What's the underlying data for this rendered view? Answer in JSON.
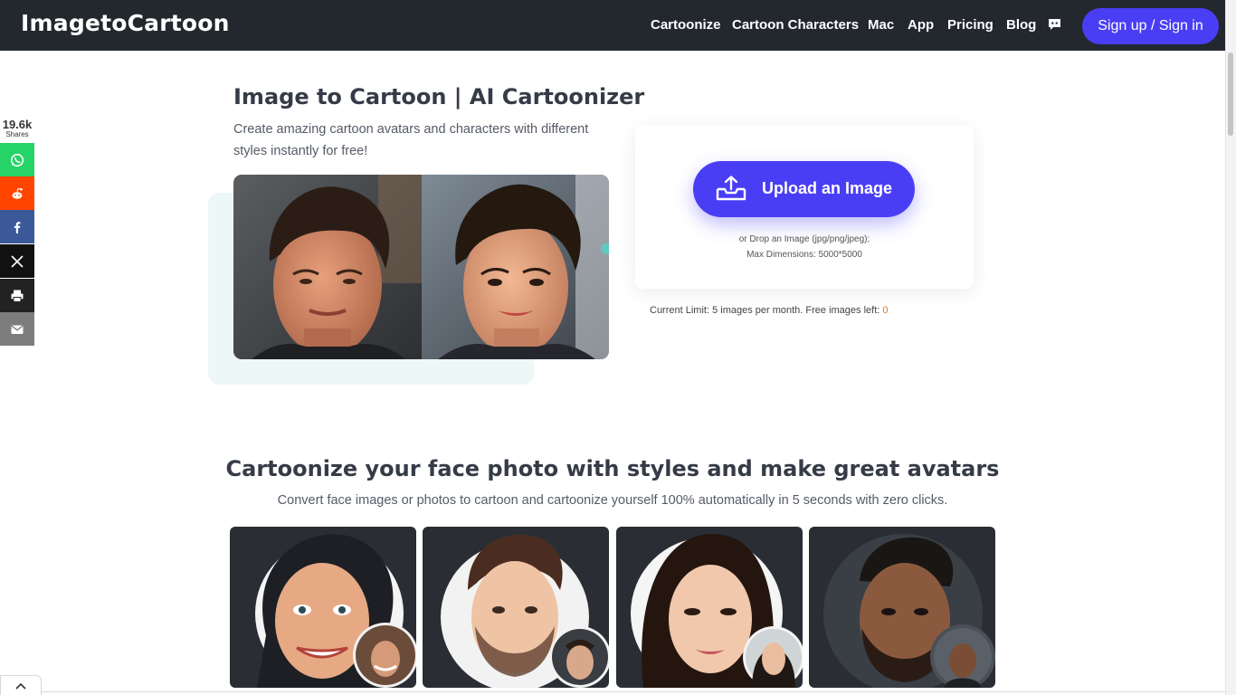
{
  "header": {
    "logo": "ImagetoCartoon",
    "nav": [
      "Cartoonize",
      "Cartoon Characters",
      "Mac",
      "App",
      "Pricing",
      "Blog"
    ],
    "signin_label": "Sign up / Sign in"
  },
  "share": {
    "count": "19.6k",
    "label": "Shares",
    "buttons": [
      {
        "name": "whatsapp",
        "color": "#25d366"
      },
      {
        "name": "reddit",
        "color": "#ff4500"
      },
      {
        "name": "facebook",
        "color": "#3b5998"
      },
      {
        "name": "x",
        "color": "#111111"
      },
      {
        "name": "print",
        "color": "#222222"
      },
      {
        "name": "email",
        "color": "#7d7d7d"
      }
    ]
  },
  "hero": {
    "title": "Image to Cartoon | AI Cartoonizer",
    "subtitle": "Create amazing cartoon avatars and characters with different styles instantly for free!"
  },
  "upload": {
    "button_label": "Upload an Image",
    "hint_line1": "or Drop an Image (jpg/png/jpeg);",
    "hint_line2": "Max Dimensions: 5000*5000",
    "limit_text": "Current Limit: 5 images per month. Free images left:",
    "limit_value": "0"
  },
  "section": {
    "title": "Cartoonize your face photo with styles and make great avatars",
    "subtitle": "Convert face images or photos to cartoon and cartoonize yourself 100% automatically in 5 seconds with zero clicks."
  },
  "colors": {
    "accent": "#4a3ef5",
    "header_bg": "#23272e",
    "limit_value": "#e5761f"
  }
}
